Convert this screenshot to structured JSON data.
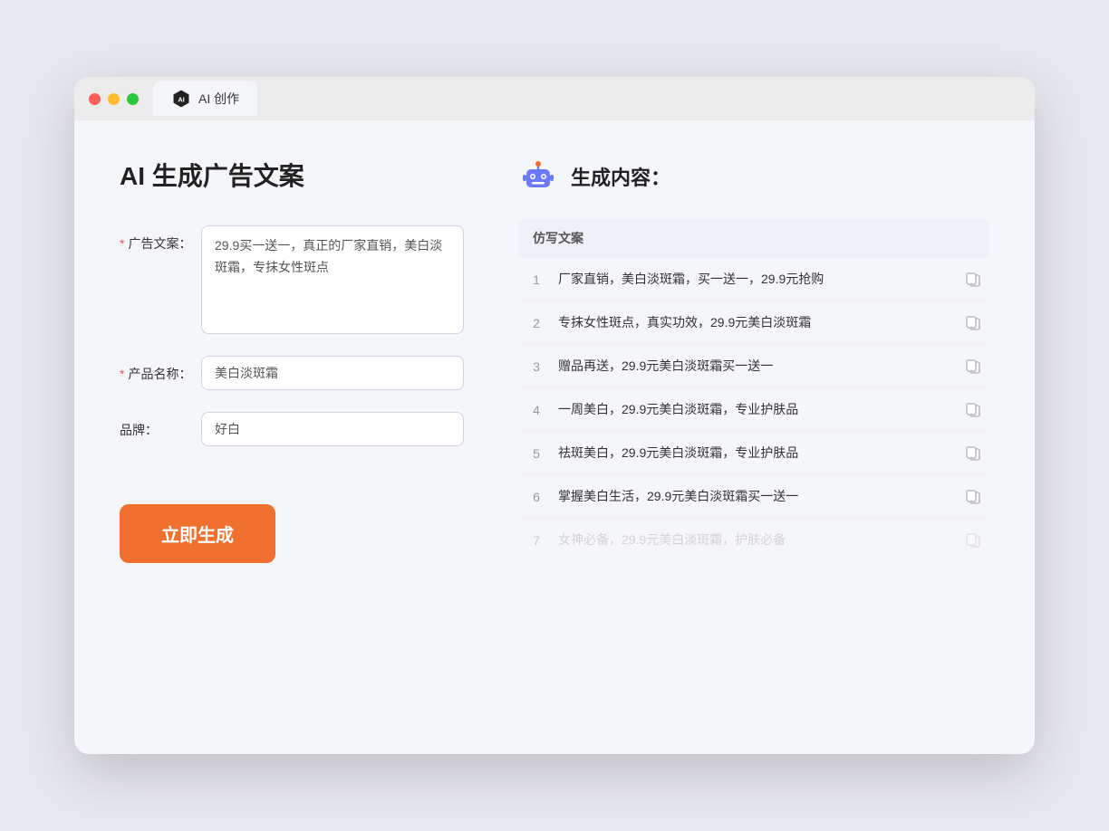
{
  "window": {
    "tab_label": "AI 创作"
  },
  "left": {
    "title": "AI 生成广告文案",
    "fields": [
      {
        "label": "广告文案：",
        "required": true,
        "type": "textarea",
        "value": "29.9买一送一，真正的厂家直销，美白淡斑霜，专抹女性斑点",
        "name": "ad-copy-input"
      },
      {
        "label": "产品名称：",
        "required": true,
        "type": "input",
        "value": "美白淡斑霜",
        "name": "product-name-input"
      },
      {
        "label": "品牌：",
        "required": false,
        "type": "input",
        "value": "好白",
        "name": "brand-input"
      }
    ],
    "button_label": "立即生成"
  },
  "right": {
    "title": "生成内容：",
    "table_header": "仿写文案",
    "results": [
      {
        "num": "1",
        "text": "厂家直销，美白淡斑霜，买一送一，29.9元抢购"
      },
      {
        "num": "2",
        "text": "专抹女性斑点，真实功效，29.9元美白淡斑霜"
      },
      {
        "num": "3",
        "text": "赠品再送，29.9元美白淡斑霜买一送一"
      },
      {
        "num": "4",
        "text": "一周美白，29.9元美白淡斑霜，专业护肤品"
      },
      {
        "num": "5",
        "text": "祛斑美白，29.9元美白淡斑霜，专业护肤品"
      },
      {
        "num": "6",
        "text": "掌握美白生活，29.9元美白淡斑霜买一送一"
      },
      {
        "num": "7",
        "text": "女神必备，29.9元美白淡斑霜，护肤必备",
        "faded": true
      }
    ]
  }
}
